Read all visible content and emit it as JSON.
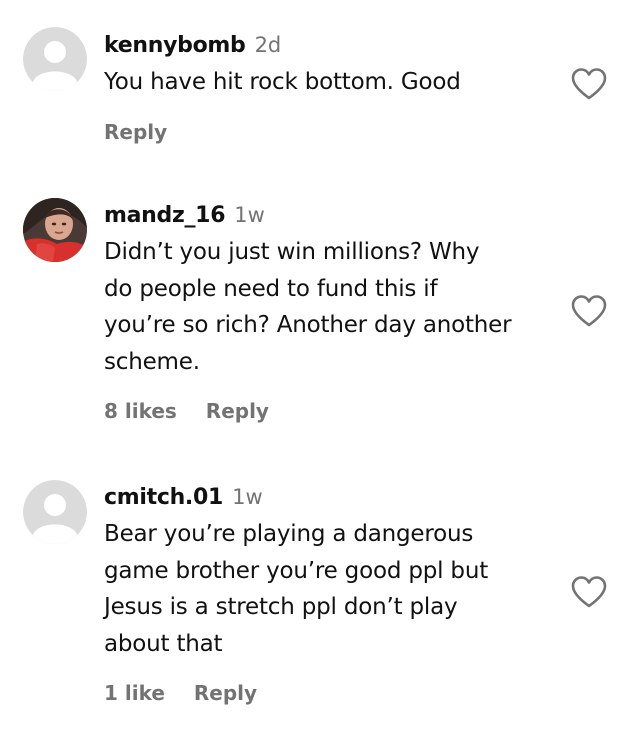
{
  "comments": [
    {
      "username": "kennybomb",
      "time": "2d",
      "lines": [
        "You have hit rock bottom. Good"
      ],
      "likes": "",
      "reply": "Reply",
      "avatar": "default-avatar-icon"
    },
    {
      "username": "mandz_16",
      "time": "1w",
      "lines": [
        "Didn’t you just win millions? Why",
        "do people need to fund this if",
        "you’re so rich? Another day another",
        "scheme."
      ],
      "likes": "8 likes",
      "reply": "Reply",
      "avatar": "photo-avatar"
    },
    {
      "username": "cmitch.01",
      "time": "1w",
      "lines": [
        "Bear you’re playing a dangerous",
        "game brother you’re good ppl but",
        "Jesus is a stretch ppl don’t play",
        "about that"
      ],
      "likes": "1 like",
      "reply": "Reply",
      "avatar": "default-avatar-icon"
    }
  ],
  "colors": {
    "text": "#111111",
    "muted": "#737373",
    "avatar_bg": "#dbdbdb",
    "avatar_fg": "#ffffff"
  }
}
